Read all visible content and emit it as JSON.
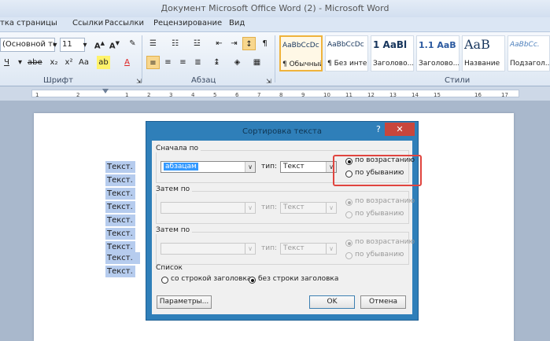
{
  "window": {
    "title": "Документ Microsoft Office Word (2) - Microsoft Word"
  },
  "ribbon": {
    "tabs": [
      "тка страницы",
      "Ссылки",
      "Рассылки",
      "Рецензирование",
      "Вид"
    ],
    "font": {
      "name": "(Основной те",
      "size": "11",
      "group_label": "Шрифт"
    },
    "paragraph": {
      "group_label": "Абзац"
    },
    "styles": {
      "group_label": "Стили",
      "items": [
        {
          "preview": "AaBbCcDc",
          "name": "¶ Обычный"
        },
        {
          "preview": "AaBbCcDc",
          "name": "¶ Без инте..."
        },
        {
          "preview": "1 AaBl",
          "name": "Заголово..."
        },
        {
          "preview": "1.1 AaB",
          "name": "Заголово..."
        },
        {
          "preview": "AaB",
          "name": "Название"
        },
        {
          "preview": "AaBbCc.",
          "name": "Подзагол..."
        }
      ]
    }
  },
  "ruler": {
    "ticks": [
      "1",
      "2",
      "1",
      "2",
      "3",
      "4",
      "5",
      "6",
      "7",
      "8",
      "9",
      "10",
      "11",
      "12",
      "13",
      "14",
      "15",
      "16",
      "17"
    ]
  },
  "document": {
    "lines": [
      "Текст.",
      "Текст.",
      "Текст.",
      "Текст.",
      "Текст.",
      "Текст.",
      "Текст.",
      "Текст.",
      "Текст."
    ]
  },
  "dialog": {
    "title": "Сортировка текста",
    "help": "?",
    "close": "✕",
    "sort1": {
      "label": "Сначала по",
      "field": "абзацам",
      "type_label": "тип:",
      "type": "Текст",
      "asc": "по возрастанию",
      "desc": "по убыванию"
    },
    "sort2": {
      "label": "Затем по",
      "field": "",
      "type_label": "тип:",
      "type": "Текст",
      "asc": "по возрастанию",
      "desc": "по убыванию"
    },
    "sort3": {
      "label": "Затем по",
      "field": "",
      "type_label": "тип:",
      "type": "Текст",
      "asc": "по возрастанию",
      "desc": "по убыванию"
    },
    "list": {
      "label": "Список",
      "with_header": "со строкой заголовка",
      "without_header": "без строки заголовка"
    },
    "buttons": {
      "options": "Параметры...",
      "ok": "OK",
      "cancel": "Отмена"
    }
  },
  "colors": {
    "accent_dialog": "#2f7fb9",
    "highlight": "#e0453f",
    "selection": "#b6ccee"
  }
}
